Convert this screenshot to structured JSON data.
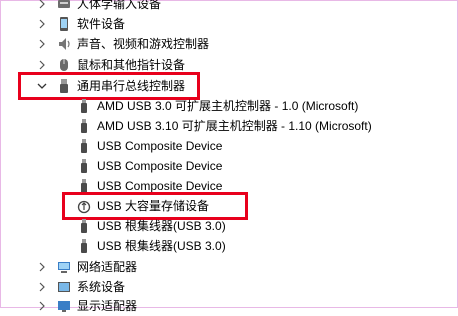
{
  "tree": {
    "categories_top": [
      {
        "label": "人体学输入设备",
        "icon": "hid-icon"
      },
      {
        "label": "软件设备",
        "icon": "software-device-icon"
      },
      {
        "label": "声音、视频和游戏控制器",
        "icon": "audio-icon"
      },
      {
        "label": "鼠标和其他指针设备",
        "icon": "mouse-icon"
      }
    ],
    "usb_controllers": {
      "label": "通用串行总线控制器",
      "expanded": true,
      "icon": "usb-icon",
      "children": [
        {
          "label": "AMD USB 3.0 可扩展主机控制器 - 1.0 (Microsoft)",
          "icon": "usb-plug-icon"
        },
        {
          "label": "AMD USB 3.10 可扩展主机控制器 - 1.10 (Microsoft)",
          "icon": "usb-plug-icon"
        },
        {
          "label": "USB Composite Device",
          "icon": "usb-plug-icon"
        },
        {
          "label": "USB Composite Device",
          "icon": "usb-plug-icon"
        },
        {
          "label": "USB Composite Device",
          "icon": "usb-plug-icon"
        },
        {
          "label": "USB 大容量存储设备",
          "icon": "usb-storage-icon"
        },
        {
          "label": "USB 根集线器(USB 3.0)",
          "icon": "usb-plug-icon"
        },
        {
          "label": "USB 根集线器(USB 3.0)",
          "icon": "usb-plug-icon"
        }
      ]
    },
    "categories_bottom": [
      {
        "label": "网络适配器",
        "icon": "network-adapter-icon"
      },
      {
        "label": "系统设备",
        "icon": "system-device-icon"
      },
      {
        "label": "显示适配器",
        "icon": "display-adapter-icon"
      }
    ]
  },
  "colors": {
    "highlight": "#e8001c",
    "frame": "#e8b8e6"
  }
}
